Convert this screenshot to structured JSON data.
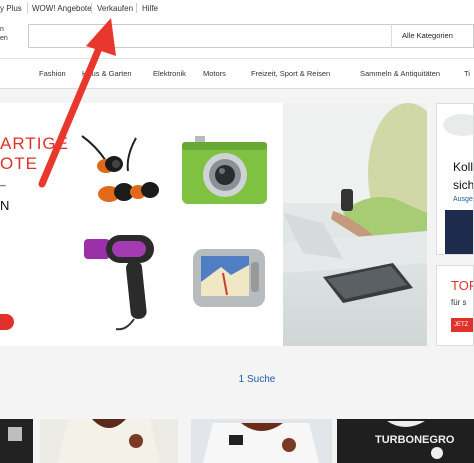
{
  "topbar": {
    "links": [
      "y Plus",
      "WOW! Angebote",
      "Verkaufen",
      "Hilfe"
    ]
  },
  "search": {
    "shop_by_line1": "n",
    "shop_by_line2": "en",
    "placeholder": "",
    "category": "Alle Kategorien"
  },
  "catnav": {
    "items": [
      "Fashion",
      "Haus & Garten",
      "Elektronik",
      "Motors",
      "Freizeit, Sport & Reisen",
      "Sammeln & Antiquitäten",
      "Ti"
    ]
  },
  "hero": {
    "headline_line1": "ARTIGE",
    "headline_line2": "OTE",
    "sub_line1": "_",
    "sub_line2": "N"
  },
  "right_panel_top": {
    "line1": "Koll",
    "line2": "sich",
    "link": "Ausge"
  },
  "right_panel_bottom": {
    "title": "TOR",
    "sub": "für s",
    "button": "JETZ"
  },
  "result_count": "1 Suche",
  "jersey_text": "TURBONEGRO",
  "colors": {
    "accent_red": "#e0322a",
    "link_blue": "#1f5aa8",
    "arrow_red": "#e8372c"
  }
}
